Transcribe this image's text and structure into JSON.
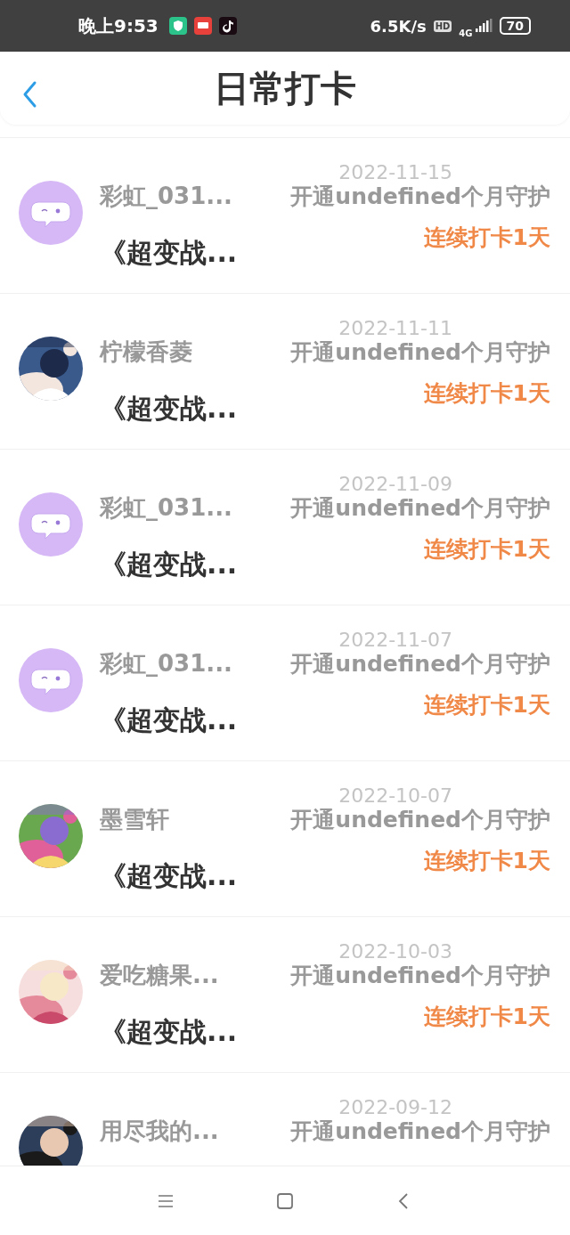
{
  "status_bar": {
    "time": "晚上9:53",
    "speed": "6.5K/s",
    "hd": "HD",
    "network": "4G",
    "battery": "70"
  },
  "header": {
    "title": "日常打卡"
  },
  "records": [
    {
      "avatar": {
        "kind": "mascot"
      },
      "name": "彩虹_031...",
      "date": "2022-11-15",
      "note": "开通undefined个月守护",
      "streak": "连续打卡1天",
      "book": "《超变战..."
    },
    {
      "name": "柠檬香菱",
      "date": "2022-11-11",
      "note": "开通undefined个月守护",
      "streak": "连续打卡1天",
      "book": "《超变战..."
    },
    {
      "avatar": {
        "kind": "mascot"
      },
      "name": "彩虹_031...",
      "date": "2022-11-09",
      "note": "开通undefined个月守护",
      "streak": "连续打卡1天",
      "book": "《超变战..."
    },
    {
      "avatar": {
        "kind": "mascot"
      },
      "name": "彩虹_031...",
      "date": "2022-11-07",
      "note": "开通undefined个月守护",
      "streak": "连续打卡1天",
      "book": "《超变战..."
    },
    {
      "name": "墨雪轩",
      "date": "2022-10-07",
      "note": "开通undefined个月守护",
      "streak": "连续打卡1天",
      "book": "《超变战..."
    },
    {
      "name": "爱吃糖果...",
      "date": "2022-10-03",
      "note": "开通undefined个月守护",
      "streak": "连续打卡1天",
      "book": "《超变战..."
    },
    {
      "name": "用尽我的...",
      "date": "2022-09-12",
      "note": "开通undefined个月守护"
    }
  ]
}
